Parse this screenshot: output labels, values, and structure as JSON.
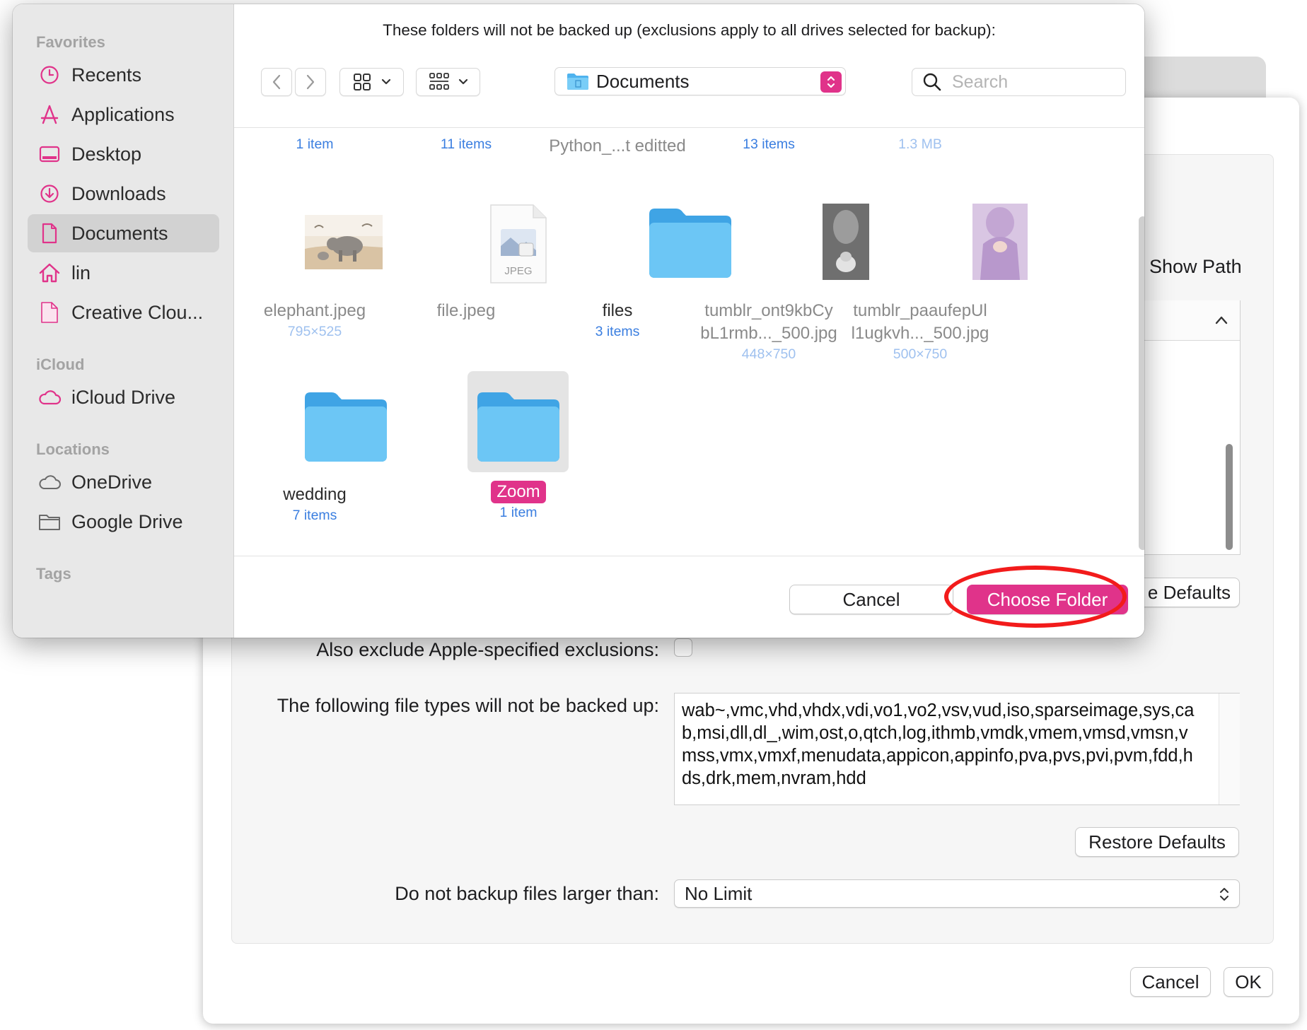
{
  "dialog": {
    "prompt": "These folders will not be backed up (exclusions apply to all drives selected for backup):",
    "location": "Documents",
    "search_placeholder": "Search",
    "cancel_label": "Cancel",
    "choose_label": "Choose Folder"
  },
  "sidebar": {
    "favorites_header": "Favorites",
    "icloud_header": "iCloud",
    "locations_header": "Locations",
    "tags_header": "Tags",
    "items": [
      {
        "label": "Recents",
        "icon": "clock-icon"
      },
      {
        "label": "Applications",
        "icon": "applications-icon"
      },
      {
        "label": "Desktop",
        "icon": "desktop-icon"
      },
      {
        "label": "Downloads",
        "icon": "downloads-icon"
      },
      {
        "label": "Documents",
        "icon": "document-icon",
        "selected": true
      },
      {
        "label": "lin",
        "icon": "home-icon"
      },
      {
        "label": "Creative Clou...",
        "icon": "document-icon"
      },
      {
        "label": "iCloud Drive",
        "icon": "cloud-icon"
      },
      {
        "label": "OneDrive",
        "icon": "cloud-icon"
      },
      {
        "label": "Google Drive",
        "icon": "folder-outline-icon"
      }
    ]
  },
  "files": {
    "row0": [
      {
        "sub": "1 item"
      },
      {
        "sub": "11 items"
      },
      {
        "name": "Python_...t editted"
      },
      {
        "sub": "13 items"
      },
      {
        "sub": "1.3 MB"
      }
    ],
    "row1": [
      {
        "name": "elephant.jpeg",
        "sub": "795×525"
      },
      {
        "name": "file.jpeg",
        "thumb_text": "JPEG"
      },
      {
        "name": "files",
        "sub": "3 items"
      },
      {
        "name1": "tumblr_ont9kbCy",
        "name2": "bL1rmb..._500.jpg",
        "sub": "448×750"
      },
      {
        "name1": "tumblr_paaufepUl",
        "name2": "l1ugkvh..._500.jpg",
        "sub": "500×750"
      }
    ],
    "row2": [
      {
        "name": "wedding",
        "sub": "7 items"
      },
      {
        "name": "Zoom",
        "sub": "1 item",
        "selected": true
      }
    ]
  },
  "prefs": {
    "show_path": "Show Path",
    "defaults_partial": "e Defaults",
    "apple_exclusions_label": "Also exclude Apple-specified exclusions:",
    "apple_exclusions_checked": false,
    "file_types_label": "The following file types will not be backed up:",
    "file_types_value": "wab~,vmc,vhd,vhdx,vdi,vo1,vo2,vsv,vud,iso,sparseimage,sys,cab,msi,dll,dl_,wim,ost,o,qtch,log,ithmb,vmdk,vmem,vmsd,vmsn,vmss,vmx,vmxf,menudata,appicon,appinfo,pva,pvs,pvi,pvm,fdd,hds,drk,mem,nvram,hdd",
    "restore_defaults": "Restore Defaults",
    "size_label": "Do not backup files larger than:",
    "size_value": "No Limit",
    "cancel": "Cancel",
    "ok": "OK"
  },
  "colors": {
    "accent": "#e0338a",
    "folder": "#6cc6f5",
    "annotation_ring": "#f21b1b"
  }
}
